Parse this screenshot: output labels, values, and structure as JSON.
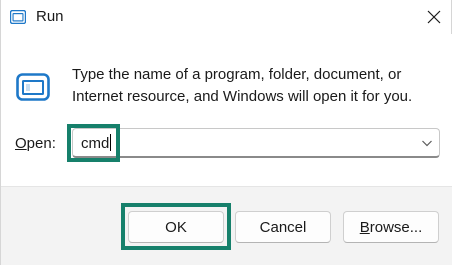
{
  "window": {
    "title": "Run",
    "app_icon": "run-icon",
    "close_icon": "close-icon"
  },
  "description": {
    "line1": "Type the name of a program, folder, document, or",
    "line2": "Internet resource, and Windows will open it for you."
  },
  "open_field": {
    "label_accel": "O",
    "label_rest": "pen:",
    "value": "cmd",
    "dropdown_icon": "chevron-down-icon"
  },
  "buttons": {
    "ok": "OK",
    "cancel": "Cancel",
    "browse_accel": "B",
    "browse_rest": "rowse..."
  },
  "colors": {
    "highlight": "#16806b",
    "footer_bg": "#f3f3f3",
    "icon_blue": "#1e78c8"
  }
}
